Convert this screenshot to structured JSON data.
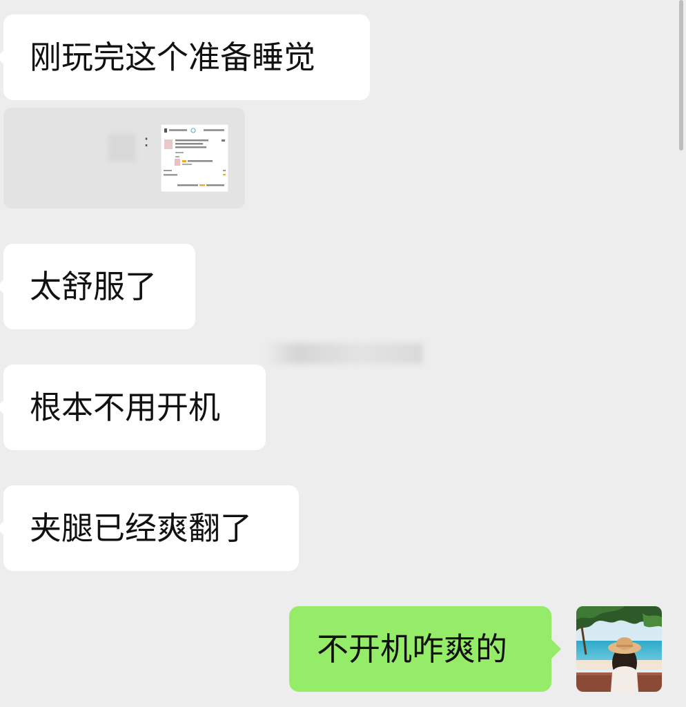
{
  "messages": [
    {
      "side": "in",
      "text": "刚玩完这个准备睡觉"
    },
    {
      "side": "in",
      "type": "card",
      "text": ":"
    },
    {
      "side": "in",
      "text": "太舒服了"
    },
    {
      "side": "in",
      "text": "根本不用开机"
    },
    {
      "side": "in",
      "text": "夹腿已经爽翻了"
    },
    {
      "side": "out",
      "text": "不开机咋爽的"
    }
  ],
  "colors": {
    "background": "#EDEDED",
    "incoming_bubble": "#FFFFFF",
    "outgoing_bubble": "#95EC69",
    "card_background": "#E3E3E3"
  },
  "icons": {
    "avatar": "avatar-beach-girl-hat"
  }
}
